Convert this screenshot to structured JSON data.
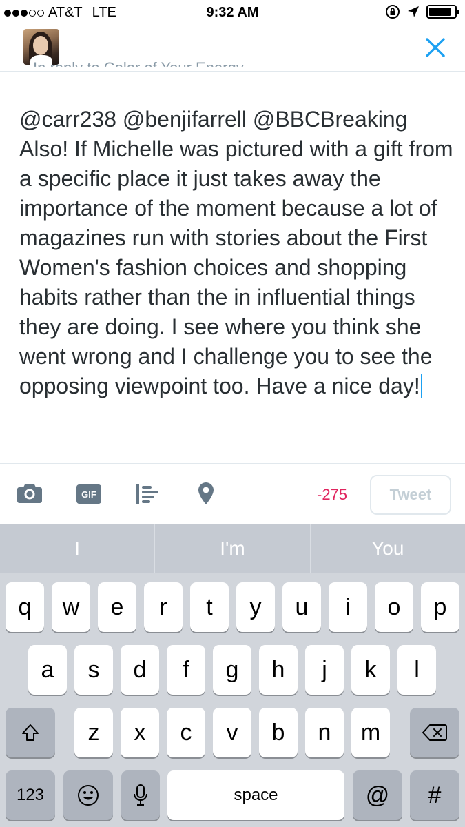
{
  "status_bar": {
    "carrier": "AT&T",
    "network": "LTE",
    "time": "9:32 AM",
    "signal_bars_filled": 3,
    "signal_bars_total": 5,
    "battery_level": 0.85
  },
  "header": {
    "reply_to": "In reply to Color of Your Energy",
    "close_icon": "close-icon",
    "accent_color": "#1da1f2"
  },
  "compose": {
    "text": "@carr238 @benjifarrell @BBCBreaking Also! If Michelle was pictured with a gift from a specific place it just takes away the importance of the moment because a lot of magazines run with stories about the First Women's fashion choices and shopping habits rather than the in influential things they are doing. I see where you think she went wrong and I challenge you to see the opposing viewpoint too. Have a nice day!"
  },
  "toolbar": {
    "icons": [
      "camera-icon",
      "gif-icon",
      "poll-icon",
      "location-pin-icon"
    ],
    "gif_label": "GIF",
    "char_count": "-275",
    "char_count_color": "#e0245e",
    "tweet_label": "Tweet"
  },
  "keyboard": {
    "suggestions": [
      "I",
      "I'm",
      "You"
    ],
    "row1": [
      "q",
      "w",
      "e",
      "r",
      "t",
      "y",
      "u",
      "i",
      "o",
      "p"
    ],
    "row2": [
      "a",
      "s",
      "d",
      "f",
      "g",
      "h",
      "j",
      "k",
      "l"
    ],
    "row3": [
      "z",
      "x",
      "c",
      "v",
      "b",
      "n",
      "m"
    ],
    "numbers_label": "123",
    "space_label": "space",
    "at_label": "@",
    "hash_label": "#"
  }
}
